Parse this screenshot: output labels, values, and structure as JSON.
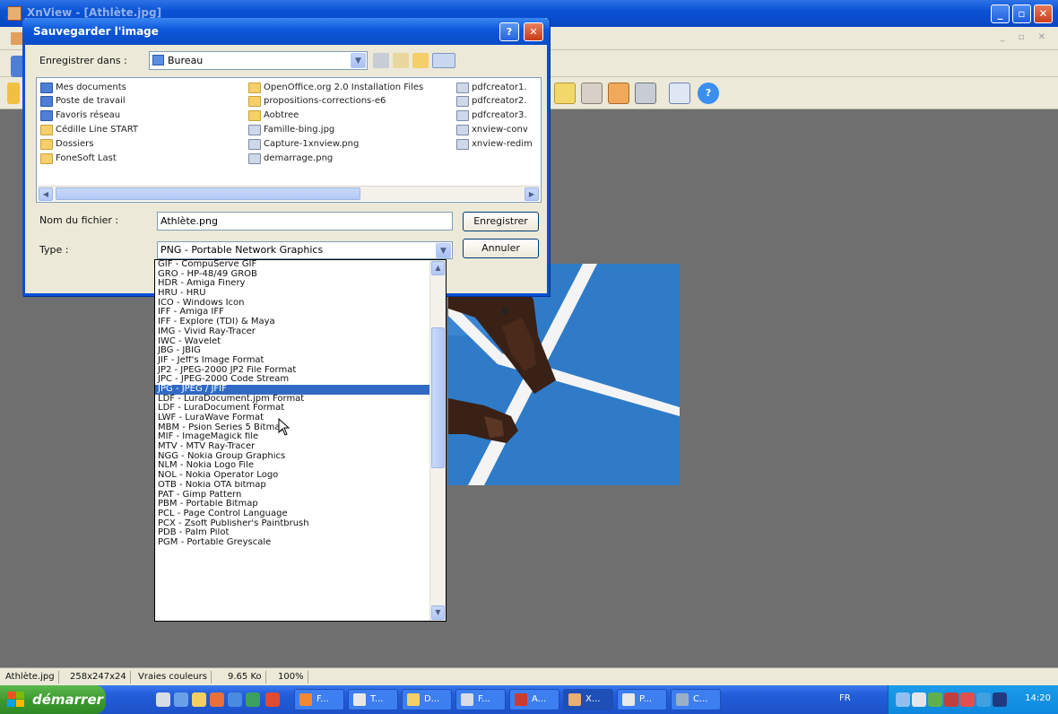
{
  "app": {
    "title": "XnView - [Athlète.jpg]",
    "menu_controls": "_ ▫ ✕"
  },
  "dialog": {
    "title": "Sauvegarder l'image",
    "save_in_label": "Enregistrer dans :",
    "save_in_value": "Bureau",
    "files": [
      {
        "name": "Mes documents",
        "kind": "sys"
      },
      {
        "name": "Poste de travail",
        "kind": "sys"
      },
      {
        "name": "Favoris réseau",
        "kind": "sys"
      },
      {
        "name": "Cédille Line START",
        "kind": "folder"
      },
      {
        "name": "Dossiers",
        "kind": "folder"
      },
      {
        "name": "FoneSoft Last",
        "kind": "folder"
      },
      {
        "name": "OpenOffice.org 2.0 Installation Files",
        "kind": "folder"
      },
      {
        "name": "propositions-corrections-e6",
        "kind": "folder"
      },
      {
        "name": "Aobtree",
        "kind": "folder"
      },
      {
        "name": "Famille-bing.jpg",
        "kind": "image"
      },
      {
        "name": "Capture-1xnview.png",
        "kind": "image"
      },
      {
        "name": "demarrage.png",
        "kind": "image"
      },
      {
        "name": "pdfcreator1.",
        "kind": "image"
      },
      {
        "name": "pdfcreator2.",
        "kind": "image"
      },
      {
        "name": "pdfcreator3.",
        "kind": "image"
      },
      {
        "name": "xnview-conv",
        "kind": "image"
      },
      {
        "name": "xnview-redim",
        "kind": "image"
      }
    ],
    "filename_label": "Nom du fichier :",
    "filename_value": "Athlète.png",
    "type_label": "Type :",
    "type_value": "PNG - Portable Network Graphics",
    "save_button": "Enregistrer",
    "cancel_button": "Annuler",
    "type_options": [
      "GIF - CompuServe GIF",
      "GRO - HP-48/49 GROB",
      "HDR - Amiga Finery",
      "HRU - HRU",
      "ICO - Windows Icon",
      "IFF - Amiga IFF",
      "IFF - Explore (TDI) & Maya",
      "IMG - Vivid Ray-Tracer",
      "IWC - Wavelet",
      "JBG - JBIG",
      "JIF - Jeff's Image Format",
      "JP2 - JPEG-2000 JP2 File Format",
      "JPC - JPEG-2000 Code Stream",
      "JPG - JPEG / JFIF",
      "LDF - LuraDocument.jpm Format",
      "LDF - LuraDocument Format",
      "LWF - LuraWave Format",
      "MBM - Psion Series 5 Bitmap",
      "MIF - ImageMagick file",
      "MTV - MTV Ray-Tracer",
      "NGG - Nokia Group Graphics",
      "NLM - Nokia Logo File",
      "NOL - Nokia Operator Logo",
      "OTB - Nokia OTA bitmap",
      "PAT - Gimp Pattern",
      "PBM - Portable Bitmap",
      "PCL - Page Control Language",
      "PCX - Zsoft Publisher's Paintbrush",
      "PDB - Palm Pilot",
      "PGM - Portable Greyscale"
    ],
    "selected_option_index": 13
  },
  "statusbar": {
    "filename": "Athlète.jpg",
    "dimensions": "258x247x24",
    "colors": "Vraies couleurs",
    "size": "9.65 Ko",
    "zoom": "100%"
  },
  "taskbar": {
    "start_label": "démarrer",
    "tasks": [
      "F...",
      "T...",
      "D...",
      "F...",
      "A...",
      "X...",
      "P...",
      "C..."
    ],
    "language": "FR",
    "clock": "14:20"
  },
  "colors": {
    "xp_blue": "#0a4fd6",
    "selection": "#316ac5",
    "track_blue": "#2f7bc8",
    "start_green": "#3c9a2f"
  }
}
